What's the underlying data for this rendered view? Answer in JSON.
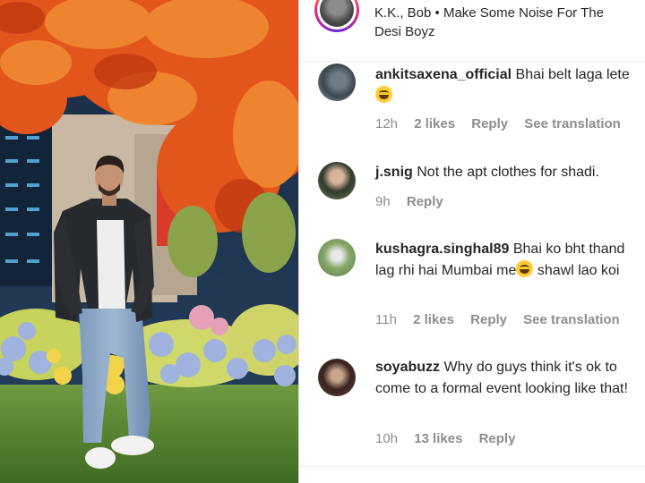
{
  "post": {
    "audio": "K.K., Bob • Make Some Noise For The Desi Boyz"
  },
  "comments": [
    {
      "username": "ankitsaxena_official",
      "text": "Bhai belt laga lete",
      "emoji": "laughing-emoji",
      "time": "12h",
      "likes": "2 likes",
      "reply": "Reply",
      "translation": "See translation"
    },
    {
      "username": "j.snig",
      "text": "Not the apt clothes for shadi.",
      "time": "9h",
      "reply": "Reply"
    },
    {
      "username": "kushagra.singhal89",
      "text": "Bhai ko bht thand lag rhi hai Mumbai me",
      "emoji": "laughing-emoji",
      "text2": "shawl lao koi",
      "time": "11h",
      "likes": "2 likes",
      "reply": "Reply",
      "translation": "See translation"
    },
    {
      "username": "soyabuzz",
      "text": "Why do guys think it's ok to come to a formal event looking like that!",
      "time": "10h",
      "likes": "13 likes",
      "reply": "Reply"
    }
  ],
  "colors": {
    "text_primary": "#262626",
    "text_secondary": "#8e8e8e",
    "story_ring": "#ee2a7b"
  }
}
